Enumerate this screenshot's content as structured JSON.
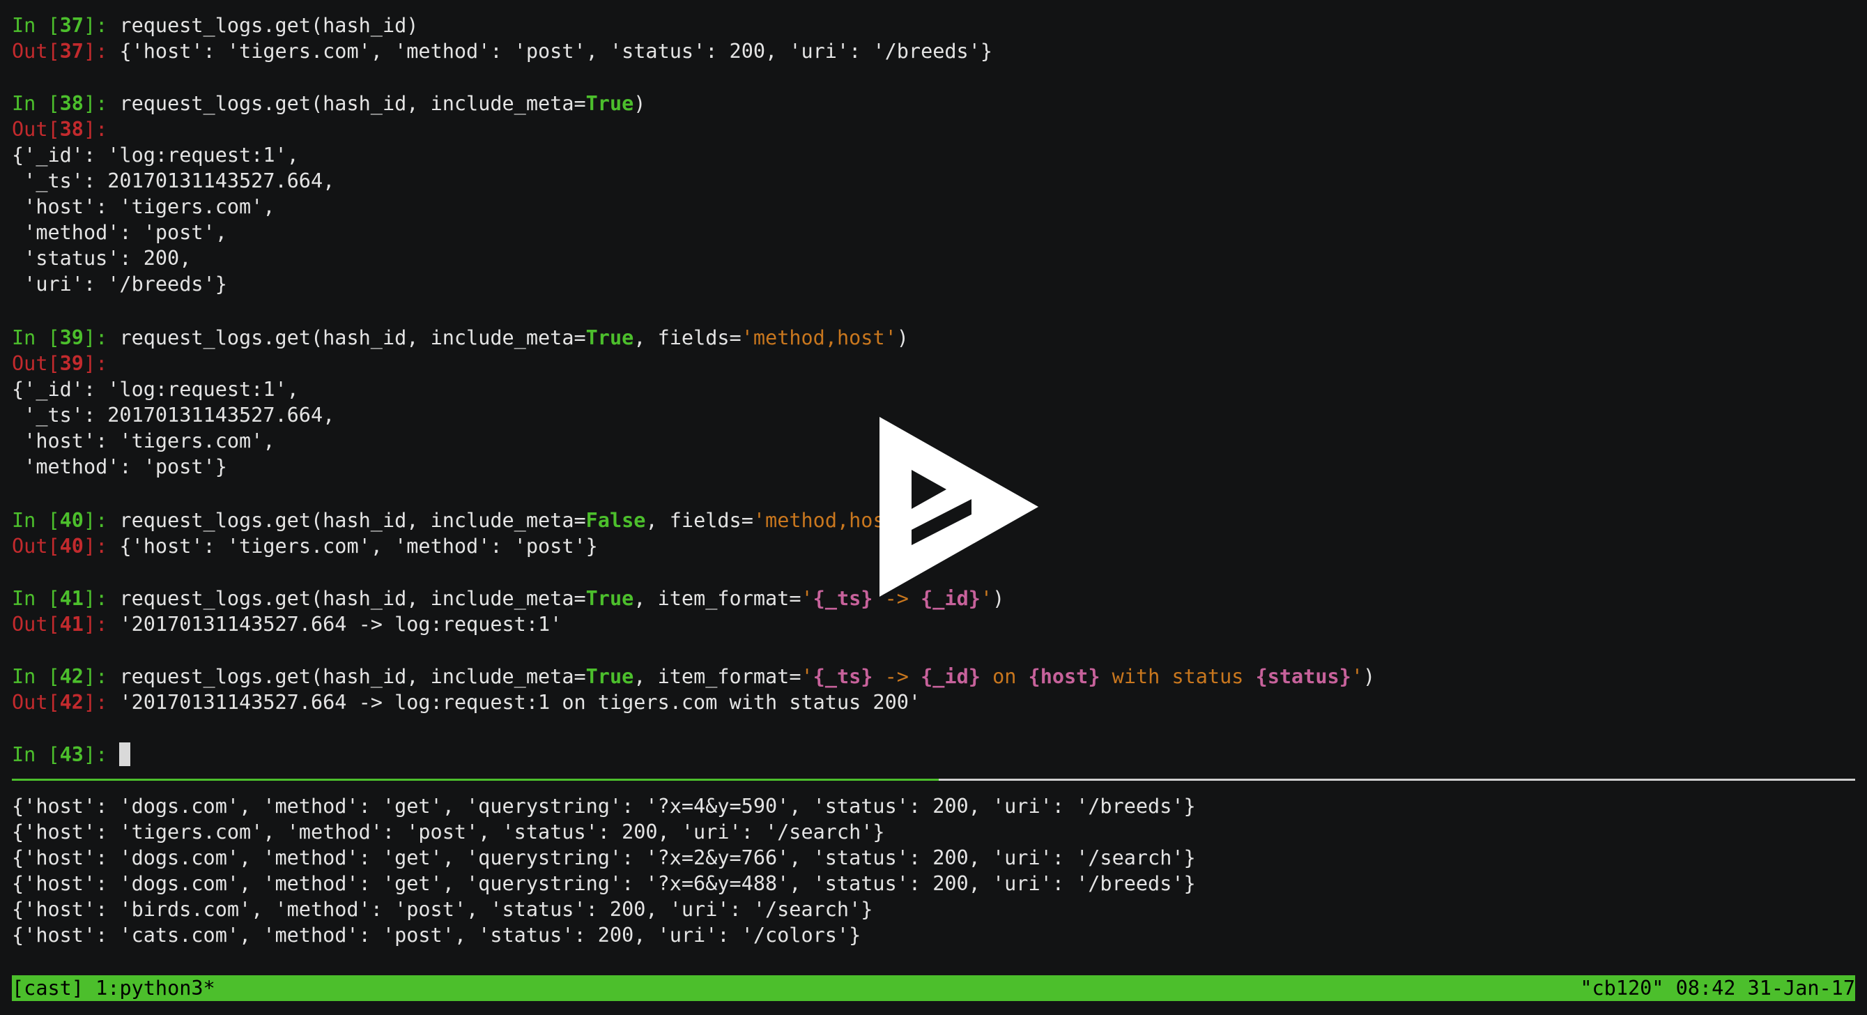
{
  "session": {
    "name": "[cast]",
    "window": "1:python3*",
    "right_status": "\"cb120\" 08:42 31-Jan-17"
  },
  "cells": [
    {
      "n": "37",
      "input": "request_logs.get(hash_id)",
      "output_inline": "{'host': 'tigers.com', 'method': 'post', 'status': 200, 'uri': '/breeds'}"
    },
    {
      "n": "38",
      "input_pre": "request_logs.get(hash_id, include_meta=",
      "input_kw": "True",
      "input_post": ")",
      "output_lines": [
        "{'_id': 'log:request:1',",
        " '_ts': 20170131143527.664,",
        " 'host': 'tigers.com',",
        " 'method': 'post',",
        " 'status': 200,",
        " 'uri': '/breeds'}"
      ]
    },
    {
      "n": "39",
      "input_pre": "request_logs.get(hash_id, include_meta=",
      "input_kw": "True",
      "input_mid": ", fields=",
      "input_str": "'method,host'",
      "input_post": ")",
      "output_lines": [
        "{'_id': 'log:request:1',",
        " '_ts': 20170131143527.664,",
        " 'host': 'tigers.com',",
        " 'method': 'post'}"
      ]
    },
    {
      "n": "40",
      "input_pre": "request_logs.get(hash_id, include_meta=",
      "input_kw": "False",
      "input_mid": ", fields=",
      "input_str": "'method,host",
      "output_inline": "{'host': 'tigers.com', 'method': 'post'}"
    },
    {
      "n": "41",
      "input_pre": "request_logs.get(hash_id, include_meta=",
      "input_kw": "True",
      "input_mid": ", item_format=",
      "q": "'",
      "f1": "{_ts}",
      "s1": " -> ",
      "f2": "{_id}",
      "input_post": ")",
      "output_inline": "'20170131143527.664 -> log:request:1'"
    },
    {
      "n": "42",
      "input_pre": "request_logs.get(hash_id, include_meta=",
      "input_kw": "True",
      "input_mid": ", item_format=",
      "q": "'",
      "f1": "{_ts}",
      "s1": " -> ",
      "f2": "{_id}",
      "s2": " on ",
      "f3": "{host}",
      "s3": " with status ",
      "f4": "{status}",
      "input_post": ")",
      "output_inline": "'20170131143527.664 -> log:request:1 on tigers.com with status 200'"
    },
    {
      "n": "43"
    }
  ],
  "prompt": {
    "in": "In [",
    "out": "Out[",
    "close": "]: "
  },
  "log_pane": [
    "{'host': 'dogs.com', 'method': 'get', 'querystring': '?x=4&y=590', 'status': 200, 'uri': '/breeds'}",
    "{'host': 'tigers.com', 'method': 'post', 'status': 200, 'uri': '/search'}",
    "{'host': 'dogs.com', 'method': 'get', 'querystring': '?x=2&y=766', 'status': 200, 'uri': '/search'}",
    "{'host': 'dogs.com', 'method': 'get', 'querystring': '?x=6&y=488', 'status': 200, 'uri': '/breeds'}",
    "{'host': 'birds.com', 'method': 'post', 'status': 200, 'uri': '/search'}",
    "{'host': 'cats.com', 'method': 'post', 'status': 200, 'uri': '/colors'}"
  ],
  "overlay": {
    "icon": "play-icon",
    "color": "#ffffff"
  }
}
